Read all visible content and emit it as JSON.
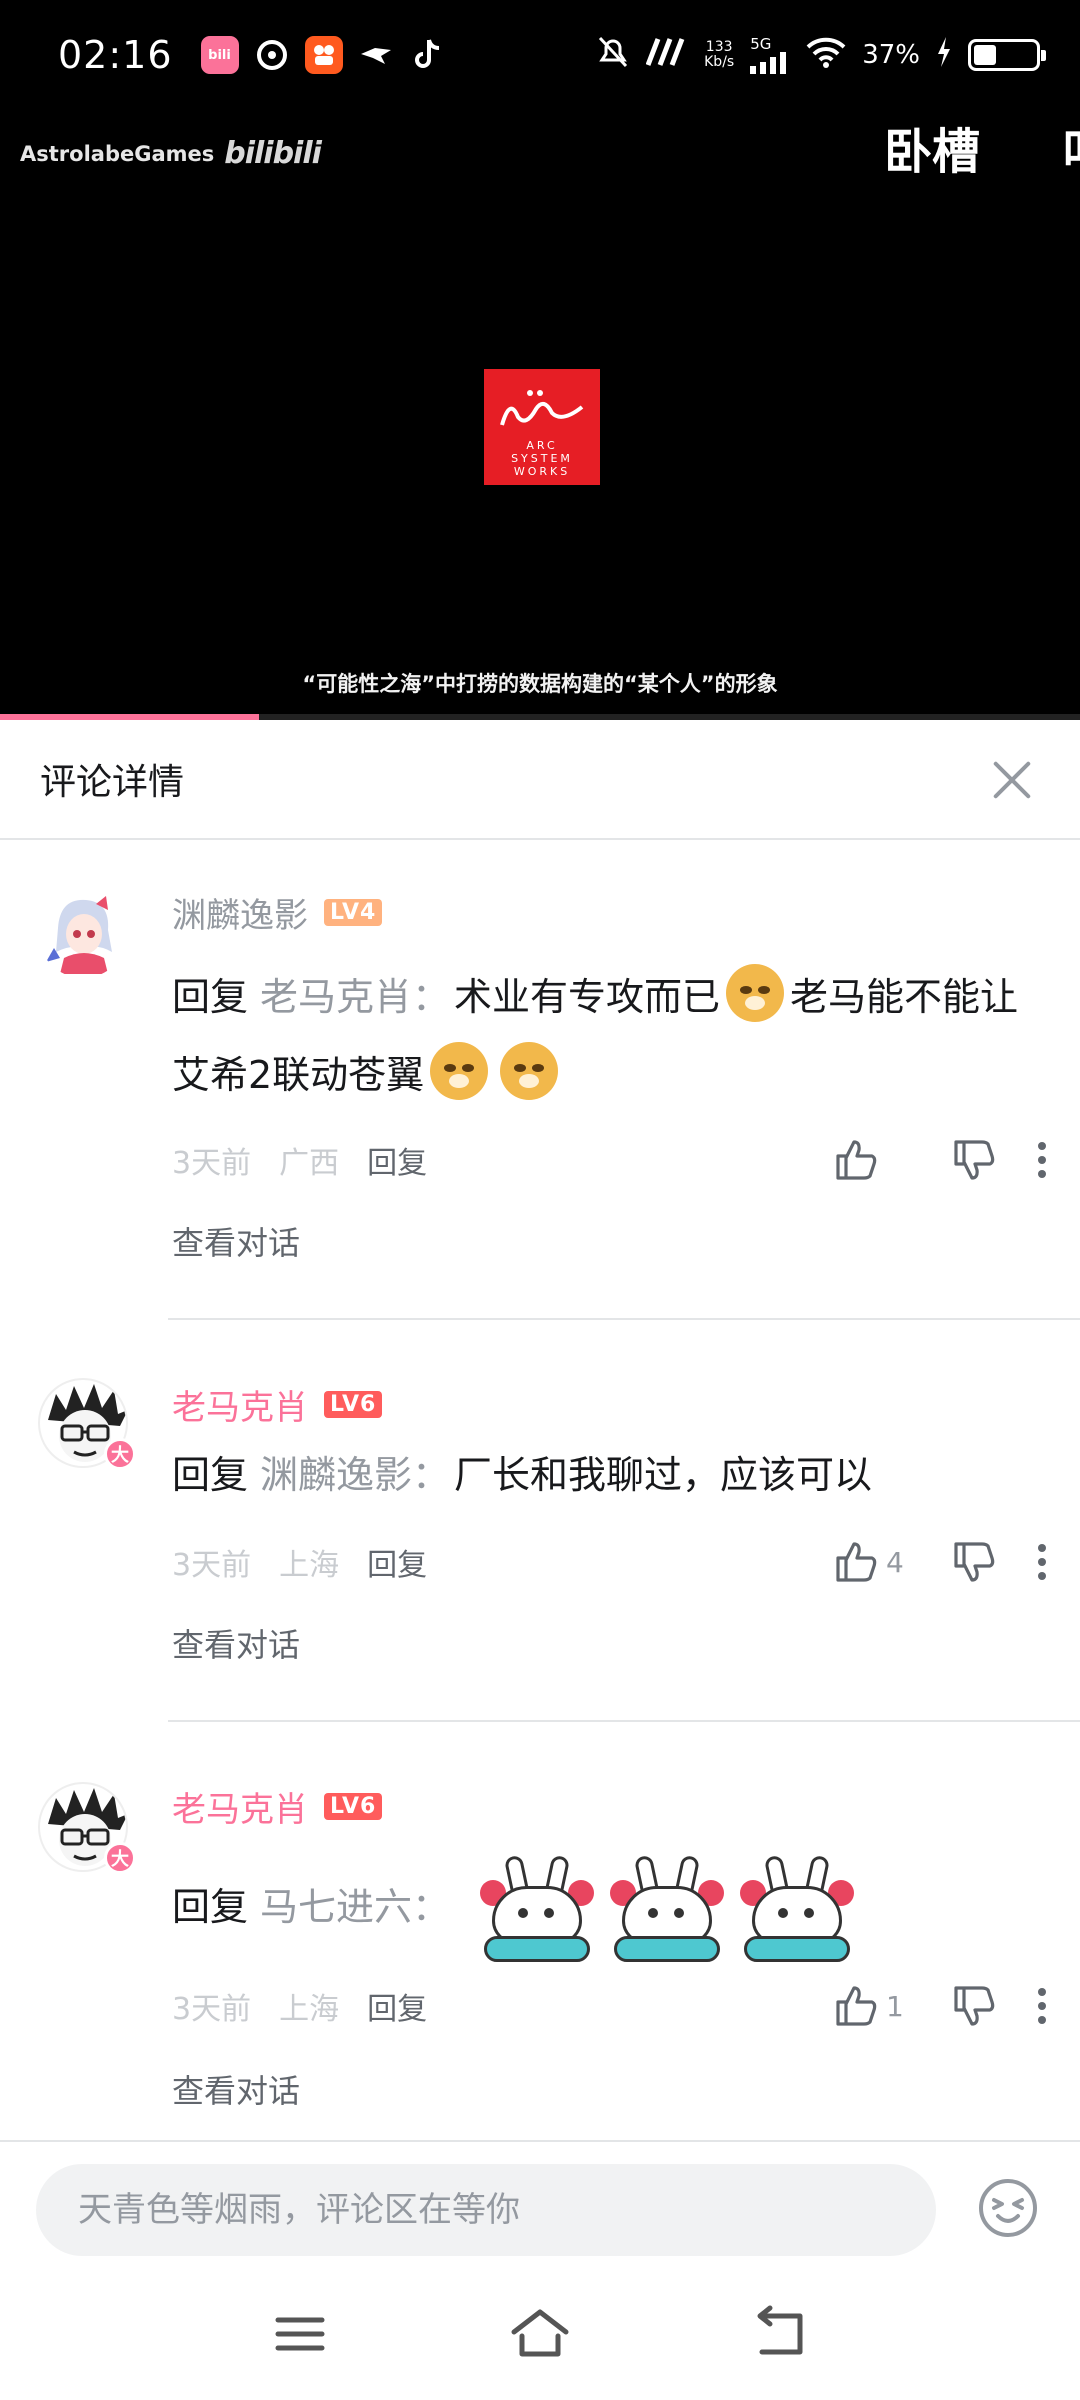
{
  "status_bar": {
    "time": "02:16",
    "net_speed_value": "133",
    "net_speed_unit": "Kb/s",
    "network": "5G",
    "battery": "37%",
    "battery_level": 0.37,
    "app_icons": [
      "bilibili-icon",
      "netease-music-icon",
      "kuaishou-icon",
      "bird-app-icon",
      "tiktok-icon"
    ]
  },
  "video": {
    "uploader": "AstrolabeGames",
    "platform_wordmark": "bilibili",
    "danmaku": [
      "卧槽",
      "叫"
    ],
    "logo_lines": [
      "ARC",
      "SYSTEM",
      "WORKS"
    ],
    "subtitle": "“可能性之海”中打捞的数据构建的“某个人”的形象",
    "progress": 0.24,
    "accent": "#fb7299"
  },
  "panel": {
    "title": "评论详情",
    "close_icon": "close-icon"
  },
  "comments": [
    {
      "username": "渊麟逸影",
      "level": "LV4",
      "reply_word": "回复",
      "reply_target": "老马克肖：",
      "text_a": "术业有专攻而已",
      "text_b": "老马能不能让艾希2联动苍翼",
      "time": "3天前",
      "location": "广西",
      "reply_label": "回复",
      "likes": "",
      "view_conversation": "查看对话"
    },
    {
      "username": "老马克肖",
      "level": "LV6",
      "badge": "大",
      "reply_word": "回复",
      "reply_target": "渊麟逸影：",
      "text": "厂长和我聊过，应该可以",
      "time": "3天前",
      "location": "上海",
      "reply_label": "回复",
      "likes": "4",
      "view_conversation": "查看对话"
    },
    {
      "username": "老马克肖",
      "level": "LV6",
      "badge": "大",
      "reply_word": "回复",
      "reply_target": "马七进六：",
      "time": "3天前",
      "location": "上海",
      "reply_label": "回复",
      "likes": "1",
      "view_conversation": "查看对话"
    }
  ],
  "input": {
    "placeholder": "天青色等烟雨，评论区在等你"
  },
  "nav": {
    "icons": [
      "menu-icon",
      "home-icon",
      "back-icon"
    ]
  }
}
